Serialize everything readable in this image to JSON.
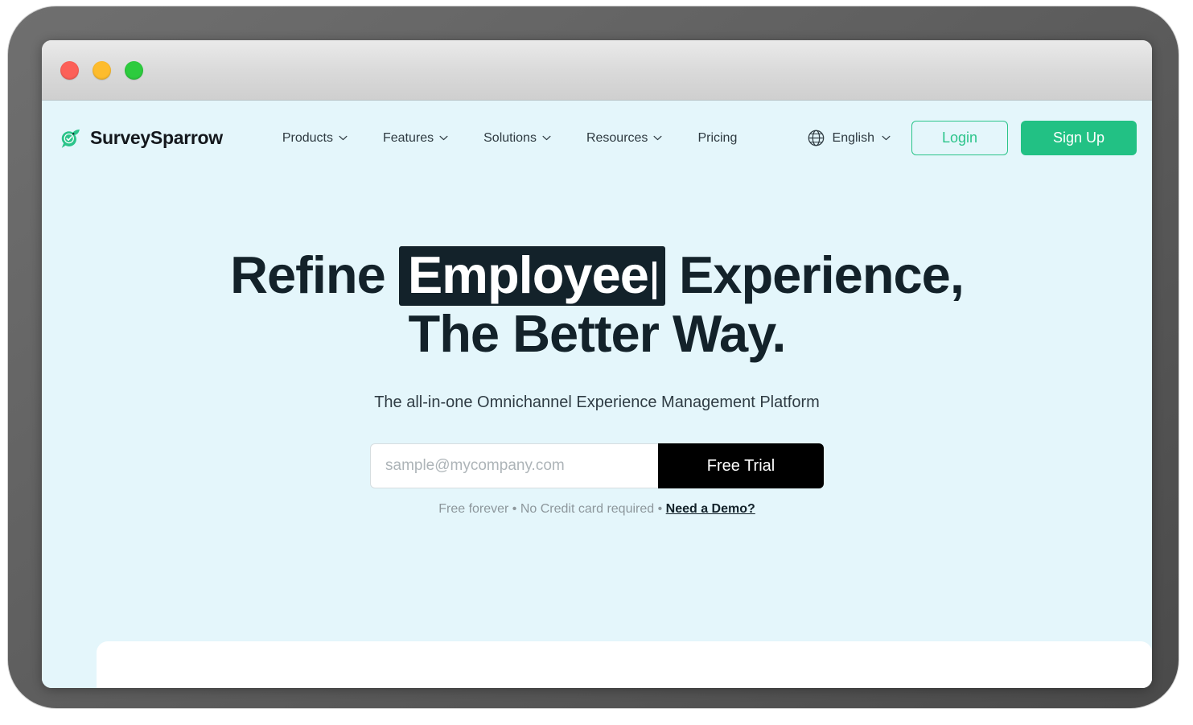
{
  "window": {
    "traffic_lights": [
      {
        "name": "close",
        "color": "#fc6058"
      },
      {
        "name": "minimize",
        "color": "#fdbc2d"
      },
      {
        "name": "maximize",
        "color": "#2dcb3e"
      }
    ]
  },
  "brand": {
    "name": "SurveySparrow",
    "logo_icon": "sparrow-check-logo",
    "logo_color": "#2bc48a"
  },
  "nav": {
    "items": [
      {
        "label": "Products",
        "has_dropdown": true
      },
      {
        "label": "Features",
        "has_dropdown": true
      },
      {
        "label": "Solutions",
        "has_dropdown": true
      },
      {
        "label": "Resources",
        "has_dropdown": true
      },
      {
        "label": "Pricing",
        "has_dropdown": false
      }
    ]
  },
  "header_right": {
    "language": {
      "icon": "globe-icon",
      "value": "English",
      "has_dropdown": true
    },
    "login_label": "Login",
    "signup_label": "Sign Up"
  },
  "hero": {
    "headline_part1": "Refine",
    "headline_highlight": "Employee",
    "headline_part2": "Experience,",
    "headline_line2": "The Better Way.",
    "subtitle": "The all-in-one Omnichannel Experience Management Platform",
    "email_placeholder": "sample@mycompany.com",
    "email_value": "",
    "cta_label": "Free Trial",
    "footnote_text": "Free forever • No Credit card required • ",
    "footnote_link": "Need a Demo?"
  },
  "colors": {
    "hero_background": "#e4f6fb",
    "brand_green": "#22c184",
    "dark": "#13222a",
    "cta_black": "#000000",
    "bezel": "#5f5f5f"
  }
}
